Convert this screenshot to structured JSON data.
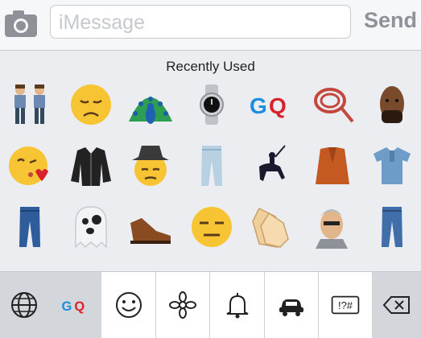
{
  "input": {
    "placeholder": "iMessage"
  },
  "send_label": "Send",
  "section_title": "Recently Used",
  "bottom_keys": {
    "gq_logo": "GQ",
    "symbols_label": "!?#"
  },
  "emoji_logo_text": "GQ",
  "colors": {
    "accent_red": "#d8232a",
    "accent_blue": "#1f8de0",
    "emoji_yellow": "#f7c534"
  }
}
